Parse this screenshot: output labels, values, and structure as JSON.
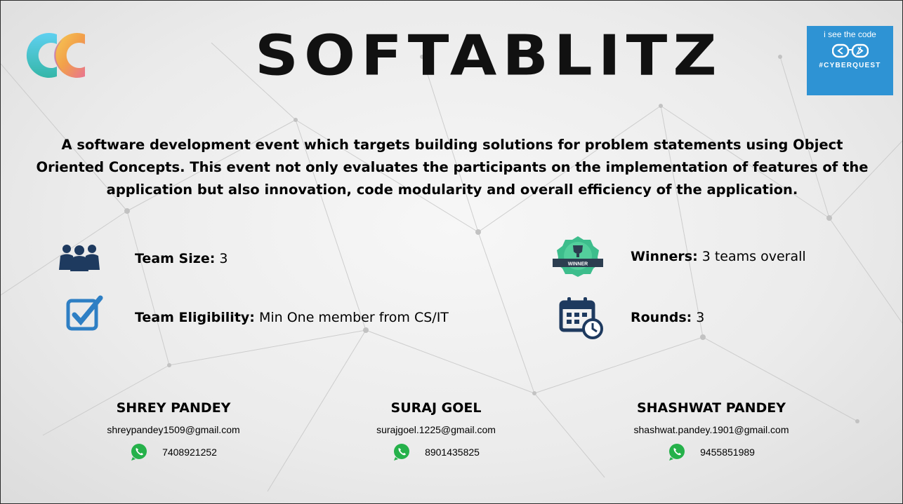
{
  "header": {
    "title": "SOFTABLITZ",
    "logo_icon": "cc-logo-icon",
    "badge": {
      "top_text": "i see the code",
      "tag_text": "#CYBERQUEST",
      "code_icon": "code-brackets-icon"
    }
  },
  "description": "A software development event which targets building solutions for problem statements using Object Oriented Concepts. This event not only evaluates the participants on the implementation of features of the application but also innovation, code modularity and overall efficiency of the application.",
  "details": {
    "team_size": {
      "label": "Team Size:",
      "value": "3",
      "icon": "team-icon"
    },
    "eligibility": {
      "label": "Team Eligibility:",
      "value": "Min One member from CS/IT",
      "icon": "checkbox-icon"
    },
    "winners": {
      "label": "Winners:",
      "value": "3 teams overall",
      "icon": "winner-badge-icon",
      "badge_text": "WINNER"
    },
    "rounds": {
      "label": "Rounds:",
      "value": "3",
      "icon": "calendar-clock-icon"
    }
  },
  "contacts": [
    {
      "name": "SHREY PANDEY",
      "email": "shreypandey1509@gmail.com",
      "phone": "7408921252"
    },
    {
      "name": "SURAJ GOEL",
      "email": "surajgoel.1225@gmail.com",
      "phone": "8901435825"
    },
    {
      "name": "SHASHWAT PANDEY",
      "email": "shashwat.pandey.1901@gmail.com",
      "phone": "9455851989"
    }
  ],
  "colors": {
    "badge_blue": "#2e93d4",
    "whatsapp_green": "#25b14a",
    "icon_blue": "#2e7fc4",
    "winner_green": "#3dbd8c",
    "dark_navy": "#1e3a5f"
  }
}
